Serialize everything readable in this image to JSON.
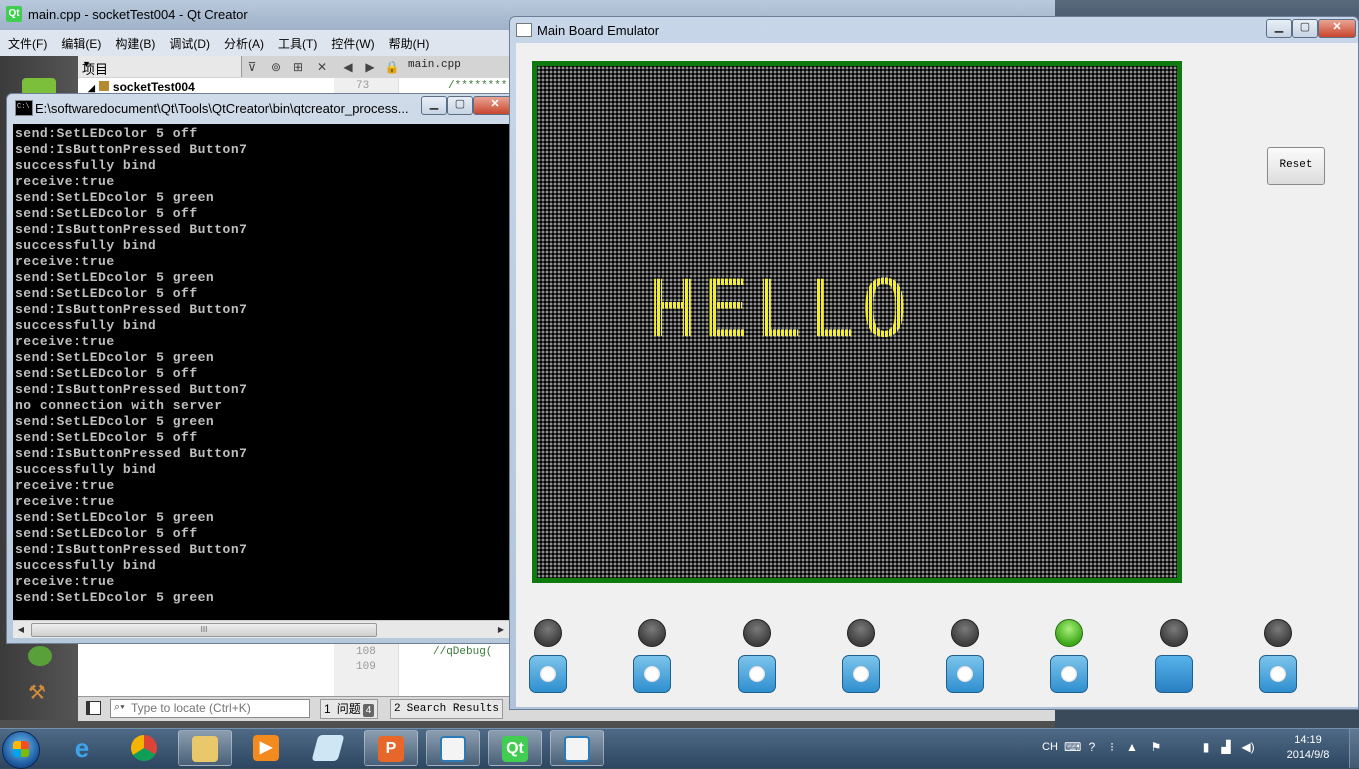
{
  "qt_creator": {
    "title": "main.cpp - socketTest004 - Qt Creator",
    "logo": "Qt",
    "menu": [
      "文件(F)",
      "编辑(E)",
      "构建(B)",
      "调试(D)",
      "分析(A)",
      "工具(T)",
      "控件(W)",
      "帮助(H)"
    ],
    "project_combo": "项目",
    "project_root": "socketTest004",
    "file_tab": "main.cpp",
    "line_numbers": [
      "73",
      "108",
      "109"
    ],
    "code_snippets": [
      "/********",
      "//qDebug("
    ],
    "locator_placeholder": "Type to locate (Ctrl+K)",
    "output_tabs": [
      {
        "num": "1",
        "label": "问题",
        "badge": "4"
      },
      {
        "num": "2",
        "label": "Search Results",
        "badge": ""
      }
    ]
  },
  "console": {
    "title": "E:\\softwaredocument\\Qt\\Tools\\QtCreator\\bin\\qtcreator_process...",
    "lines": [
      "send:SetLEDcolor 5 off",
      "send:IsButtonPressed Button7",
      "successfully bind",
      "receive:true",
      "send:SetLEDcolor 5 green",
      "send:SetLEDcolor 5 off",
      "send:IsButtonPressed Button7",
      "successfully bind",
      "receive:true",
      "send:SetLEDcolor 5 green",
      "send:SetLEDcolor 5 off",
      "send:IsButtonPressed Button7",
      "successfully bind",
      "receive:true",
      "send:SetLEDcolor 5 green",
      "send:SetLEDcolor 5 off",
      "send:IsButtonPressed Button7",
      "no connection with server",
      "send:SetLEDcolor 5 green",
      "send:SetLEDcolor 5 off",
      "send:IsButtonPressed Button7",
      "successfully bind",
      "receive:true",
      "receive:true",
      "send:SetLEDcolor 5 green",
      "send:SetLEDcolor 5 off",
      "send:IsButtonPressed Button7",
      "successfully bind",
      "receive:true",
      "send:SetLEDcolor 5 green"
    ],
    "scrollbar_grip": "III"
  },
  "emulator": {
    "title": "Main Board Emulator",
    "led_text": "HELLO",
    "led_text_color": "#f2ee2c",
    "frame_color": "#0e7a0e",
    "reset_label": "Reset",
    "status_leds": [
      "off",
      "off",
      "off",
      "off",
      "off",
      "green",
      "off",
      "off"
    ],
    "buttons": [
      "normal",
      "normal",
      "normal",
      "normal",
      "normal",
      "normal",
      "pressed",
      "normal"
    ]
  },
  "taskbar": {
    "apps": [
      "internet-explorer",
      "chrome",
      "file-explorer",
      "media-player",
      "notepad",
      "powerpoint",
      "application",
      "qt-creator",
      "application"
    ],
    "language": "CH",
    "clock_time": "14:19",
    "clock_date": "2014/9/8"
  }
}
